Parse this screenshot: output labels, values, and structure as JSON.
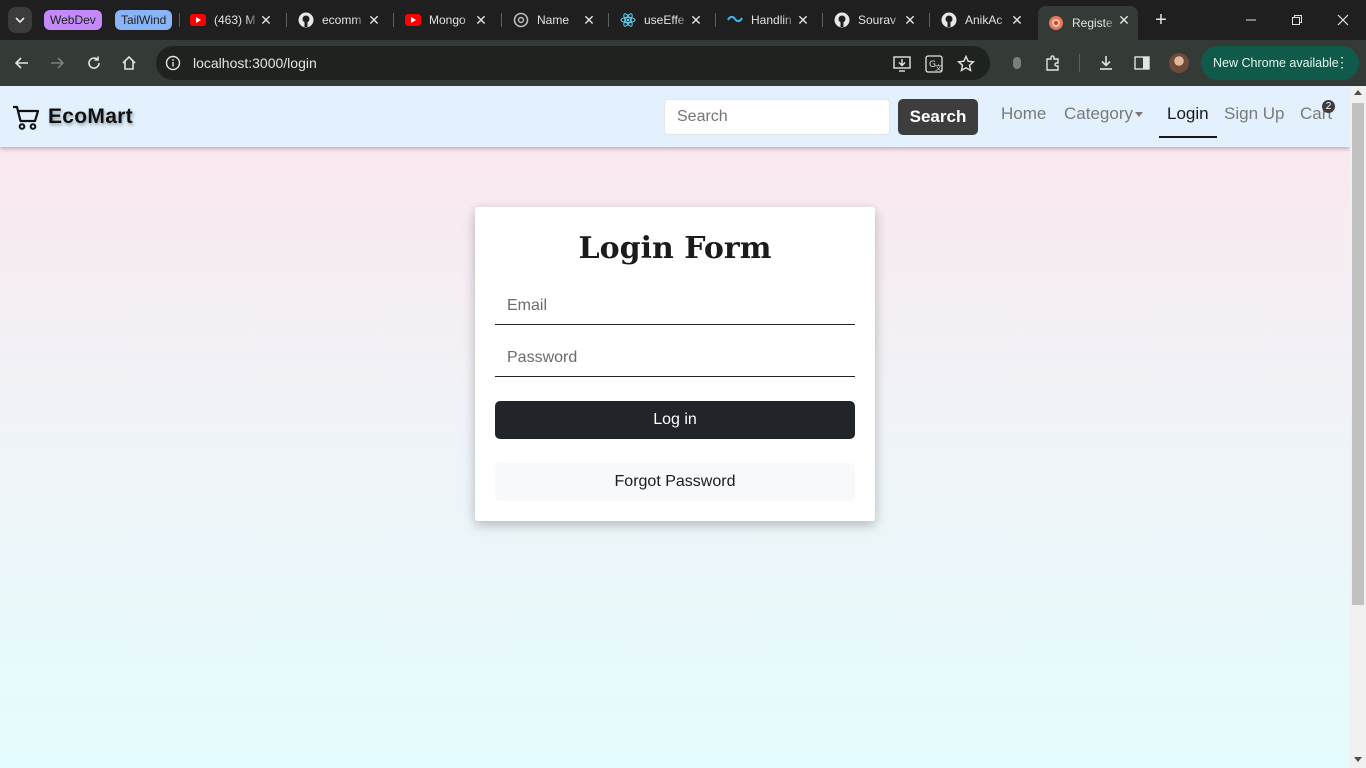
{
  "browser": {
    "tab_groups": [
      {
        "label": "WebDev",
        "color": "#c58af9"
      },
      {
        "label": "TailWind",
        "color": "#8ab4f8"
      }
    ],
    "tabs": [
      {
        "title": "(463) M",
        "icon": "youtube-icon"
      },
      {
        "title": "ecomm",
        "icon": "github-icon"
      },
      {
        "title": "Mongo",
        "icon": "youtube-icon"
      },
      {
        "title": "Name",
        "icon": "chatgpt-icon"
      },
      {
        "title": "useEffe",
        "icon": "react-icon"
      },
      {
        "title": "Handlin",
        "icon": "tailwind-icon"
      },
      {
        "title": "Sourav",
        "icon": "github-icon"
      },
      {
        "title": "AnikAc",
        "icon": "github-icon"
      },
      {
        "title": "Registe",
        "icon": "app-icon",
        "active": true
      }
    ],
    "url": "localhost:3000/login",
    "update_label": "New Chrome available"
  },
  "navbar": {
    "brand": "EcoMart",
    "search_placeholder": "Search",
    "search_button": "Search",
    "links": {
      "home": "Home",
      "category": "Category",
      "login": "Login",
      "signup": "Sign Up",
      "cart": "Cart"
    },
    "cart_count": "2"
  },
  "login_form": {
    "title": "Login Form",
    "email_placeholder": "Email",
    "password_placeholder": "Password",
    "submit_label": "Log in",
    "forgot_label": "Forgot Password"
  },
  "colors": {
    "navbar_bg": "#e2f1fd",
    "primary_button": "#212529",
    "page_gradient_top": "#fde6ee",
    "page_gradient_bottom": "#e4fcfd"
  }
}
